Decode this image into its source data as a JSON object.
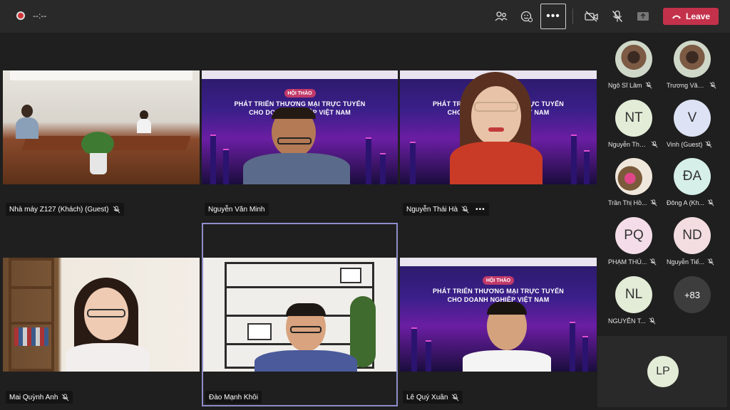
{
  "topbar": {
    "timer": "--:--",
    "more_label": "•••",
    "leave_label": "Leave",
    "icons": [
      "participants-icon",
      "raise-hand-icon",
      "more-actions-icon",
      "camera-off-icon",
      "mic-off-icon",
      "share-icon",
      "hangup-icon"
    ],
    "colors": {
      "leave": "#c4314b",
      "record": "#d13438"
    }
  },
  "stage_slide": {
    "badge": "HỘI THẢO",
    "headline_1": "PHÁT TRIỂN THƯƠNG MẠI TRỰC TUYẾN",
    "headline_2": "CHO DOANH NGHIỆP VIỆT NAM"
  },
  "tiles": [
    {
      "name": "Nhà máy Z127 (Khách) (Guest)",
      "muted": true
    },
    {
      "name": "Nguyễn Văn Minh",
      "muted": false
    },
    {
      "name": "Nguyễn Thái Hà",
      "muted": true,
      "more": "•••"
    },
    {
      "name": "Mai Quỳnh Anh",
      "muted": true
    },
    {
      "name": "Đào Mạnh Khôi",
      "muted": false,
      "active_speaker": true
    },
    {
      "name": "Lê Quý Xuân",
      "muted": true
    }
  ],
  "roster": [
    {
      "initials": "",
      "name": "Ngô Sĩ Lâm",
      "photo": true,
      "muted": true
    },
    {
      "initials": "",
      "name": "Trương Văn ...",
      "photo": true,
      "muted": true
    },
    {
      "initials": "NT",
      "name": "Nguyễn Tha...",
      "bg": "#e3ecd7",
      "muted": true
    },
    {
      "initials": "V",
      "name": "Vinh (Guest)",
      "bg": "#dde3f5",
      "muted": true
    },
    {
      "initials": "",
      "name": "Trần Thị Hồ...",
      "photo": true,
      "muted": true
    },
    {
      "initials": "ĐA",
      "name": "Đông A (Kh...",
      "bg": "#d6efe9",
      "muted": true
    },
    {
      "initials": "PQ",
      "name": "PHẠM THÚ...",
      "bg": "#f4dde8",
      "muted": true
    },
    {
      "initials": "ND",
      "name": "Nguyễn Tiế...",
      "bg": "#f3dde0",
      "muted": true
    },
    {
      "initials": "NL",
      "name": "NGUYỄN T...",
      "bg": "#e3ecd7",
      "muted": true
    },
    {
      "initials": "+83",
      "name": "",
      "bg": "#3d3d3d",
      "muted": false
    }
  ],
  "self_view": {
    "initials": "LP"
  }
}
